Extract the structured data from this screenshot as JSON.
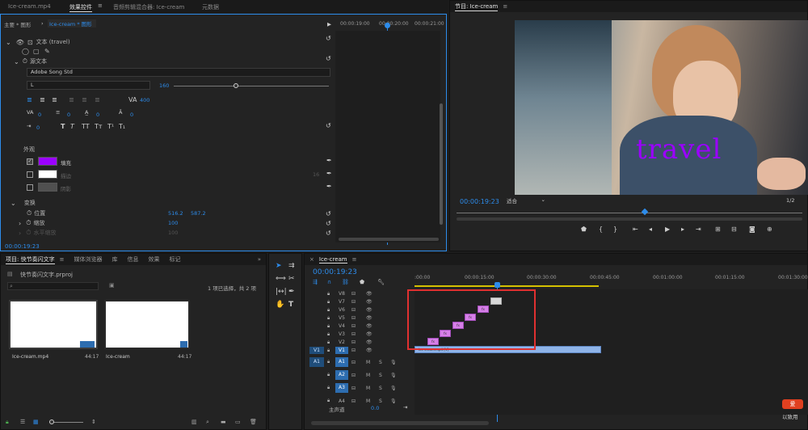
{
  "colors": {
    "accent": "#2d8ceb",
    "fill_swatch": "#9b00ff",
    "clip_pink": "#d67fe8",
    "clip_blue": "#8fb4e8",
    "playhead": "#2d8ceb",
    "highlight": "#e03030"
  },
  "source_tab": {
    "label": "Ice-cream.mp4"
  },
  "top_tabs": [
    "效果控件",
    "音频剪辑混合器: Ice-cream",
    "元数据"
  ],
  "effects": {
    "master": "主要 * 图形",
    "sequence": "Ice-cream * 图形",
    "ruler": [
      "00:00:19:00",
      "00:00:20:00",
      "00:00:21:00"
    ],
    "text_layer": "文本 (travel)",
    "source_text": "源文本",
    "font": "Adobe Song Std",
    "style": "L",
    "size": "160",
    "tracking": "400",
    "zeros": [
      "0",
      "0",
      "0",
      "0",
      "0",
      "0"
    ],
    "appearance": "外观",
    "fill": "填充",
    "stroke": "描边",
    "shadow": "阴影",
    "stroke_width": "16",
    "transform": "变换",
    "position_label": "位置",
    "pos_x": "516.2",
    "pos_y": "587.2",
    "scale_label": "缩放",
    "scale": "100",
    "uniform_scale": "水平缩放",
    "uniform_value": "100",
    "timecode": "00:00:19:23"
  },
  "program": {
    "title": "节目: Ice-cream",
    "overlay_text": "travel",
    "timecode": "00:00:19:23",
    "fit": "适合",
    "ratio": "1/2"
  },
  "project": {
    "tabs": [
      "项目: 快节奏闪文字",
      "媒体浏览器",
      "库",
      "信息",
      "效果",
      "标记"
    ],
    "file": "快节奏闪文字.prproj",
    "selection": "1 项已选择，共 2 项",
    "items": [
      {
        "name": "Ice-cream.mp4",
        "duration": "44:17"
      },
      {
        "name": "Ice-cream",
        "duration": "44:17"
      }
    ]
  },
  "timeline": {
    "tab": "Ice-cream",
    "timecode": "00:00:19:23",
    "ruler": [
      ":00:00",
      "00:00:15:00",
      "00:00:30:00",
      "00:00:45:00",
      "00:01:00:00",
      "00:01:15:00",
      "00:01:30:00"
    ],
    "video_tracks": [
      "V8",
      "V7",
      "V6",
      "V5",
      "V4",
      "V3",
      "V2",
      "V1"
    ],
    "audio_tracks": [
      "A1",
      "A2",
      "A3",
      "A4"
    ],
    "master": "主声道",
    "master_val": "0.0",
    "clip_label": "Ice-cream.mp4 [V]",
    "small_clip_label": "fx"
  },
  "watermark": {
    "line1": "爱",
    "line2": "以致用"
  }
}
